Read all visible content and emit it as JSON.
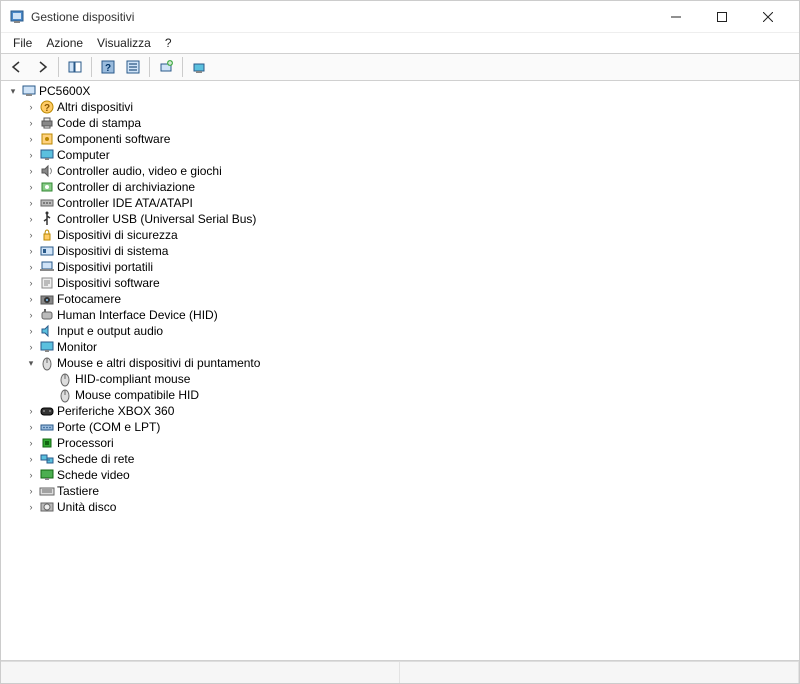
{
  "window": {
    "title": "Gestione dispositivi"
  },
  "menu": {
    "file": "File",
    "action": "Azione",
    "view": "Visualizza",
    "help": "?"
  },
  "root": {
    "name": "PC5600X"
  },
  "categories": [
    {
      "icon": "question",
      "label": "Altri dispositivi",
      "expanded": false
    },
    {
      "icon": "printer",
      "label": "Code di stampa",
      "expanded": false
    },
    {
      "icon": "component",
      "label": "Componenti software",
      "expanded": false
    },
    {
      "icon": "monitor",
      "label": "Computer",
      "expanded": false
    },
    {
      "icon": "sound",
      "label": "Controller audio, video e giochi",
      "expanded": false
    },
    {
      "icon": "storage",
      "label": "Controller di archiviazione",
      "expanded": false
    },
    {
      "icon": "ide",
      "label": "Controller IDE ATA/ATAPI",
      "expanded": false
    },
    {
      "icon": "usb",
      "label": "Controller USB (Universal Serial Bus)",
      "expanded": false
    },
    {
      "icon": "security",
      "label": "Dispositivi di sicurezza",
      "expanded": false
    },
    {
      "icon": "system",
      "label": "Dispositivi di sistema",
      "expanded": false
    },
    {
      "icon": "laptop",
      "label": "Dispositivi portatili",
      "expanded": false
    },
    {
      "icon": "software",
      "label": "Dispositivi software",
      "expanded": false
    },
    {
      "icon": "camera",
      "label": "Fotocamere",
      "expanded": false
    },
    {
      "icon": "hid",
      "label": "Human Interface Device (HID)",
      "expanded": false
    },
    {
      "icon": "audio",
      "label": "Input e output audio",
      "expanded": false
    },
    {
      "icon": "monitor",
      "label": "Monitor",
      "expanded": false
    },
    {
      "icon": "mouse",
      "label": "Mouse e altri dispositivi di puntamento",
      "expanded": true,
      "children": [
        {
          "icon": "mouse",
          "label": "HID-compliant mouse"
        },
        {
          "icon": "mouse",
          "label": "Mouse compatibile HID"
        }
      ]
    },
    {
      "icon": "xbox",
      "label": "Periferiche XBOX 360",
      "expanded": false
    },
    {
      "icon": "port",
      "label": "Porte (COM e LPT)",
      "expanded": false
    },
    {
      "icon": "cpu",
      "label": "Processori",
      "expanded": false
    },
    {
      "icon": "network",
      "label": "Schede di rete",
      "expanded": false
    },
    {
      "icon": "display",
      "label": "Schede video",
      "expanded": false
    },
    {
      "icon": "keyboard",
      "label": "Tastiere",
      "expanded": false
    },
    {
      "icon": "disk",
      "label": "Unità disco",
      "expanded": false
    }
  ]
}
